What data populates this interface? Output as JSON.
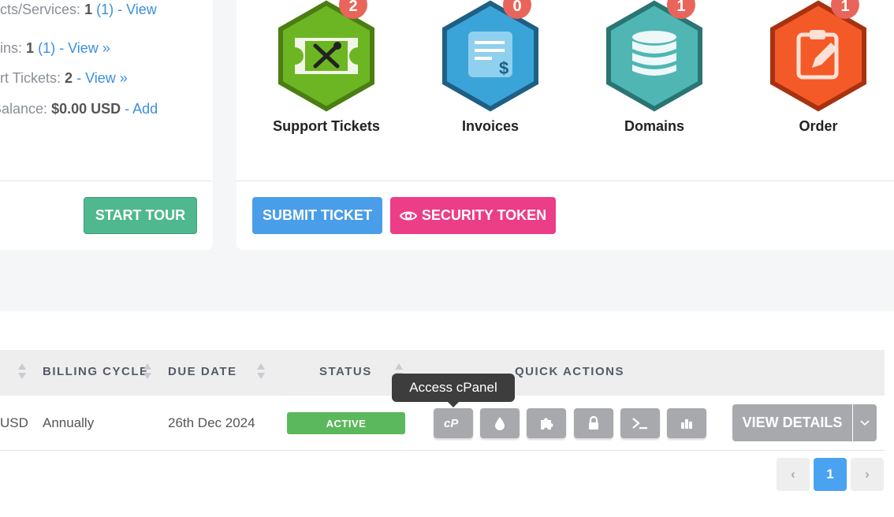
{
  "summary": {
    "services": {
      "label": "ucts/Services:",
      "count": "1",
      "paren": "(1)",
      "link": "- View"
    },
    "domains": {
      "label": "ains:",
      "count": "1",
      "paren": "(1)",
      "link": "- View »"
    },
    "tickets": {
      "label": "ort Tickets:",
      "count": "2",
      "link": "- View »"
    },
    "balance": {
      "label": "Balance:",
      "value": "$0.00 USD",
      "link": "- Add"
    },
    "start_tour": "START TOUR"
  },
  "shortcuts": [
    {
      "label": "Support Tickets",
      "badge": "2",
      "color": "#6cb523",
      "border": "#4a7d12",
      "icon": "ticket-tools-icon"
    },
    {
      "label": "Invoices",
      "badge": "0",
      "color": "#3aa4d8",
      "border": "#1f5f84",
      "icon": "invoice-dollar-icon"
    },
    {
      "label": "Domains",
      "badge": "1",
      "color": "#4fb6b4",
      "border": "#2a7574",
      "icon": "database-icon"
    },
    {
      "label": "Order",
      "badge": "1",
      "color": "#f45a28",
      "border": "#a8320f",
      "icon": "clipboard-edit-icon"
    }
  ],
  "actions": {
    "submit_ticket": "SUBMIT TICKET",
    "security_token": "SECURITY TOKEN"
  },
  "table": {
    "headers": {
      "billing_cycle": "BILLING CYCLE",
      "due_date": "DUE DATE",
      "status": "STATUS",
      "quick_actions": "QUICK ACTIONS"
    },
    "row": {
      "amount": "USD",
      "billing_cycle": "Annually",
      "due_date": "26th Dec 2024",
      "status": "ACTIVE",
      "view_details": "VIEW DETAILS"
    }
  },
  "tooltip": "Access cPanel",
  "pagination": {
    "prev": "‹",
    "current": "1",
    "next": "›"
  },
  "colors": {
    "active": "#5cb85c",
    "primary": "#4a9de8",
    "pink": "#ec3d87",
    "green": "#4fb88e"
  }
}
